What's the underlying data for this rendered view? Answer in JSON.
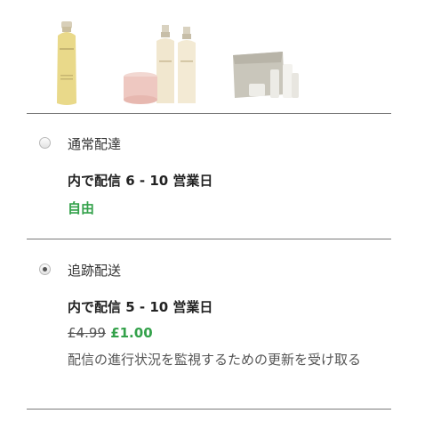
{
  "products": [
    {
      "name": "cleansing-oil-bottle"
    },
    {
      "name": "body-cream-and-bottles-set"
    },
    {
      "name": "pouch-gift-set"
    }
  ],
  "shipping_options": [
    {
      "name": "通常配達",
      "window": "内で配信  6 - 10 営業日",
      "price": "自由",
      "selected": false
    },
    {
      "name": "追跡配送",
      "window": "内で配信  5 - 10 営業日",
      "old_price": "£4.99",
      "price": "£1.00",
      "description": "配信の進行状況を監視するための更新を受け取る",
      "selected": true
    }
  ],
  "colors": {
    "accent_green": "#33a14a",
    "divider": "#7a7a7a",
    "text": "#333333"
  }
}
